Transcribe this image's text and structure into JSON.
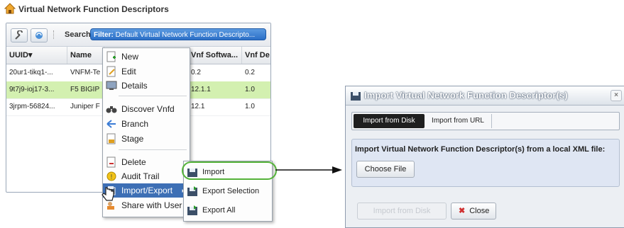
{
  "page": {
    "title": "Virtual Network Function Descriptors"
  },
  "toolbar": {
    "search_label": "Search",
    "filter_prefix": "Filter:",
    "filter_value": "Default Virtual Network Function Descripto..."
  },
  "table": {
    "columns": [
      "UUID▾",
      "Name",
      "Vnf Softwa...",
      "Vnf De"
    ],
    "rows": [
      {
        "uuid": "20ur1-tikq1-...",
        "name": "VNFM-Te",
        "software": "0.2",
        "descriptor": "0.2",
        "selected": false
      },
      {
        "uuid": "9t7j9-ioj17-3...",
        "name": "F5 BIGIP",
        "software": "12.1.1",
        "descriptor": "1.0",
        "selected": true
      },
      {
        "uuid": "3jrpm-56824...",
        "name": "Juniper F",
        "software": "12.1",
        "descriptor": "1.0",
        "selected": false
      }
    ]
  },
  "context_menu": {
    "items": [
      {
        "label": "New",
        "icon": "new-icon"
      },
      {
        "label": "Edit",
        "icon": "edit-icon"
      },
      {
        "label": "Details",
        "icon": "details-icon"
      },
      {
        "label": "Discover Vnfd",
        "icon": "binoculars-icon"
      },
      {
        "label": "Branch",
        "icon": "branch-icon"
      },
      {
        "label": "Stage",
        "icon": "stage-icon"
      },
      {
        "label": "Delete",
        "icon": "delete-icon"
      },
      {
        "label": "Audit Trail",
        "icon": "audit-icon"
      },
      {
        "label": "Import/Export",
        "icon": "import-export-icon",
        "hover": true
      },
      {
        "label": "Share with User",
        "icon": "share-icon"
      }
    ]
  },
  "submenu": {
    "items": [
      {
        "label": "Import",
        "icon": "import-icon"
      },
      {
        "label": "Export Selection",
        "icon": "export-selection-icon"
      },
      {
        "label": "Export All",
        "icon": "export-all-icon"
      }
    ]
  },
  "dialog": {
    "title": "Import Virtual Network Function Descriptor(s)",
    "close_symbol": "×",
    "tabs": [
      "Import from Disk",
      "Import from URL"
    ],
    "active_tab": "Import from Disk",
    "instruction": "Import Virtual Network Function Descriptor(s) from a local XML file:",
    "choose_file_label": "Choose File",
    "import_button_label": "Import from Disk",
    "close_button_label": "Close"
  },
  "colors": {
    "selected_row": "#d3f0b0",
    "menu_hover": "#3d6fb5",
    "highlight": "#55b33a",
    "filter_blue": "#2b6fc7"
  }
}
